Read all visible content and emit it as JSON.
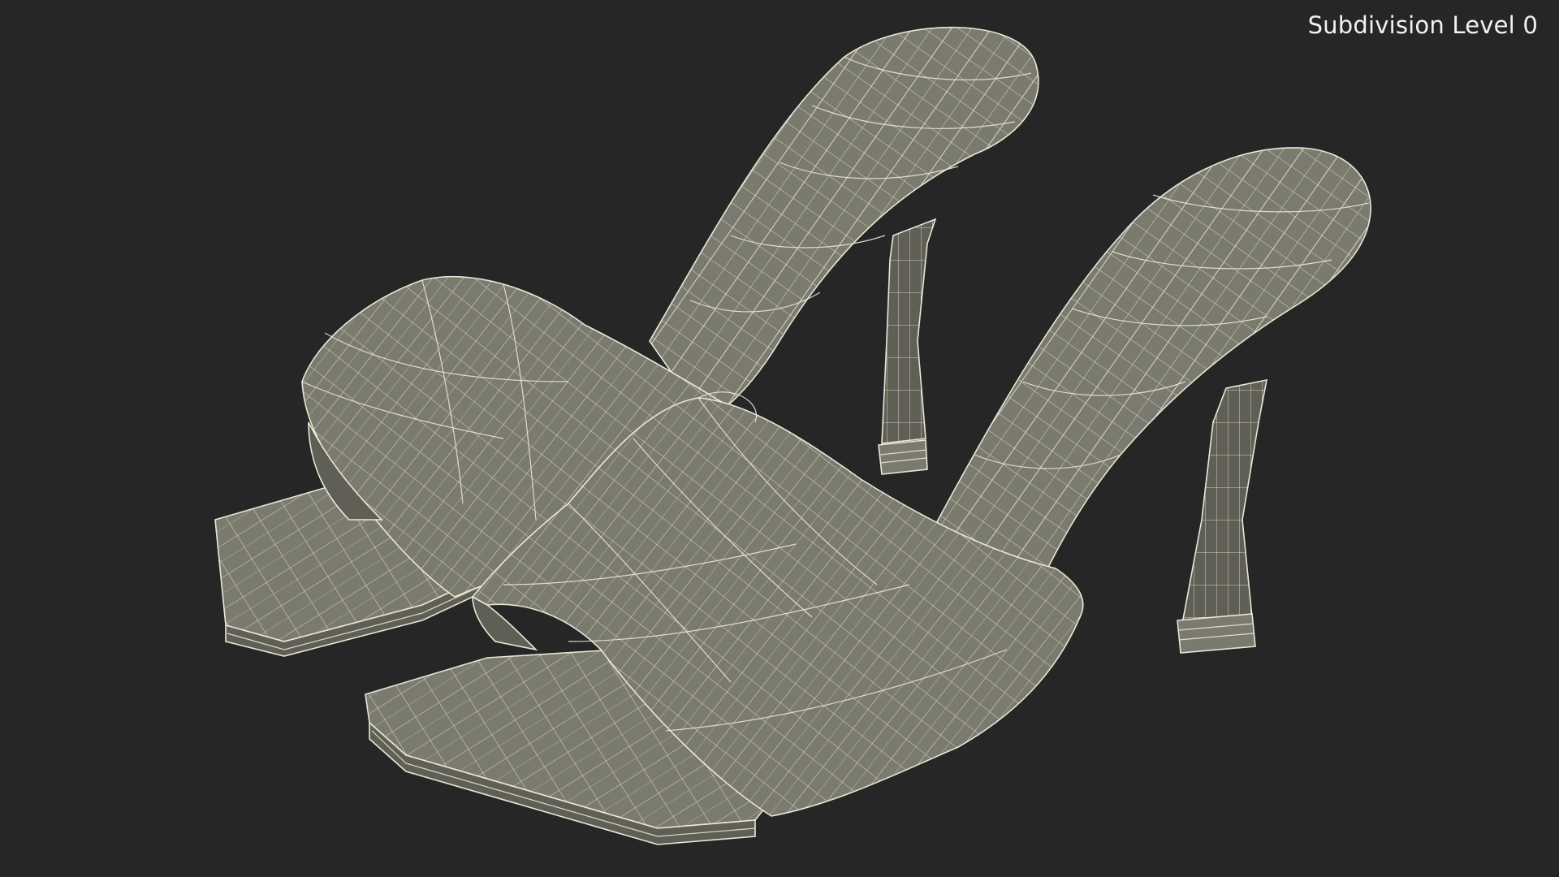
{
  "viewport": {
    "overlay_label": "Subdivision Level 0",
    "background_color": "#262626",
    "mesh_fill_color": "#7a7a6e",
    "wire_color": "#e9e7d6"
  }
}
